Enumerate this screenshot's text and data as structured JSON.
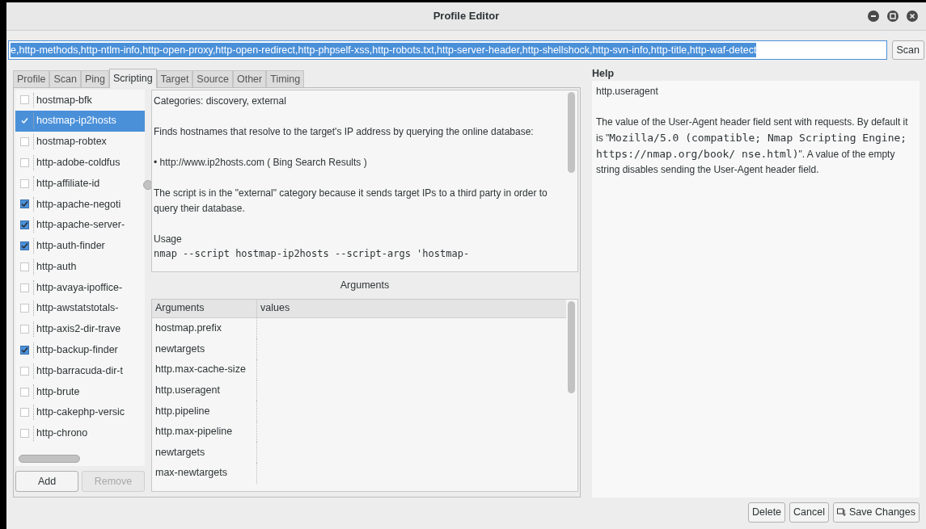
{
  "window": {
    "title": "Profile Editor"
  },
  "command": {
    "value": "e,http-methods,http-ntlm-info,http-open-proxy,http-open-redirect,http-phpself-xss,http-robots.txt,http-server-header,http-shellshock,http-svn-info,http-title,http-waf-detect",
    "button": "Scan"
  },
  "tabs": [
    {
      "label": "Profile",
      "selected": false
    },
    {
      "label": "Scan",
      "selected": false
    },
    {
      "label": "Ping",
      "selected": false
    },
    {
      "label": "Scripting",
      "selected": true
    },
    {
      "label": "Target",
      "selected": false
    },
    {
      "label": "Source",
      "selected": false
    },
    {
      "label": "Other",
      "selected": false
    },
    {
      "label": "Timing",
      "selected": false
    }
  ],
  "scripts": [
    {
      "name": "hostmap-bfk",
      "checked": false,
      "selected": false
    },
    {
      "name": "hostmap-ip2hosts",
      "checked": true,
      "selected": true
    },
    {
      "name": "hostmap-robtex",
      "checked": false,
      "selected": false
    },
    {
      "name": "http-adobe-coldfus",
      "checked": false,
      "selected": false
    },
    {
      "name": "http-affiliate-id",
      "checked": false,
      "selected": false
    },
    {
      "name": "http-apache-negoti",
      "checked": true,
      "selected": false
    },
    {
      "name": "http-apache-server-",
      "checked": true,
      "selected": false
    },
    {
      "name": "http-auth-finder",
      "checked": true,
      "selected": false
    },
    {
      "name": "http-auth",
      "checked": false,
      "selected": false
    },
    {
      "name": "http-avaya-ipoffice-",
      "checked": false,
      "selected": false
    },
    {
      "name": "http-awstatstotals-",
      "checked": false,
      "selected": false
    },
    {
      "name": "http-axis2-dir-trave",
      "checked": false,
      "selected": false
    },
    {
      "name": "http-backup-finder",
      "checked": true,
      "selected": false
    },
    {
      "name": "http-barracuda-dir-t",
      "checked": false,
      "selected": false
    },
    {
      "name": "http-brute",
      "checked": false,
      "selected": false
    },
    {
      "name": "http-cakephp-versic",
      "checked": false,
      "selected": false
    },
    {
      "name": "http-chrono",
      "checked": false,
      "selected": false
    }
  ],
  "list_buttons": [
    {
      "label": "Add",
      "disabled": false
    },
    {
      "label": "Remove",
      "disabled": true
    }
  ],
  "description": [
    {
      "kind": "text",
      "text": "Categories: discovery, external"
    },
    {
      "kind": "text",
      "text": "Finds hostnames that resolve to the target's IP address by querying the online database:"
    },
    {
      "kind": "bullet",
      "text": "• http://www.ip2hosts.com ( Bing Search Results )"
    },
    {
      "kind": "gap"
    },
    {
      "kind": "text",
      "text": "The script is in the \"external\" category because it sends target IPs to a third party in order to query their database."
    },
    {
      "kind": "text",
      "text": "Usage"
    },
    {
      "kind": "code",
      "text": "nmap --script hostmap-ip2hosts --script-args 'hostmap-"
    }
  ],
  "arguments": {
    "title": "Arguments",
    "columns": [
      "Arguments",
      "values"
    ],
    "rows": [
      "hostmap.prefix",
      "newtargets",
      "http.max-cache-size",
      "http.useragent",
      "http.pipeline",
      "http.max-pipeline",
      "newtargets",
      "max-newtargets"
    ]
  },
  "help": {
    "title": "Help",
    "heading": "http.useragent",
    "body": [
      {
        "kind": "text",
        "text": "The value of the User-Agent header field sent with requests. By default it is \""
      },
      {
        "kind": "code",
        "text": "Mozilla/5.0 (compatible; Nmap Scripting Engine; https://nmap.org/book/ nse.html)"
      },
      {
        "kind": "text",
        "text": "\". A value of the empty string disables sending the User-Agent header field."
      }
    ]
  },
  "footer_buttons": [
    {
      "label": "Delete",
      "kind": "plain"
    },
    {
      "label": "Cancel",
      "kind": "plain"
    },
    {
      "label": "Save Changes",
      "kind": "save"
    }
  ]
}
